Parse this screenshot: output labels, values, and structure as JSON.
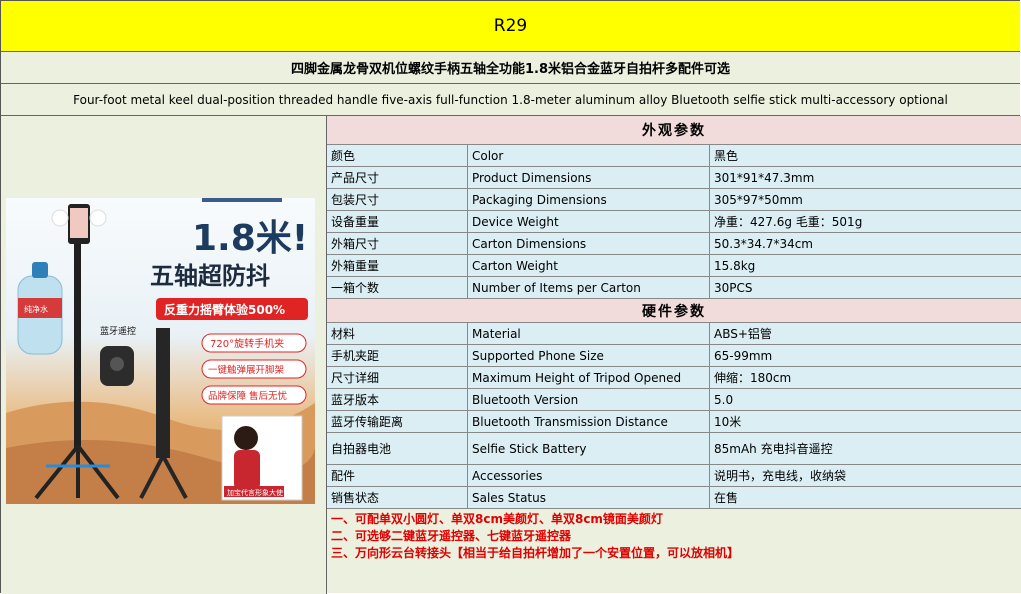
{
  "header": {
    "model": "R29",
    "title_cn": "四脚金属龙骨双机位螺纹手柄五轴全功能1.8米铝合金蓝牙自拍杆多配件可选",
    "title_en": "Four-foot metal keel dual-position threaded handle five-axis full-function 1.8-meter aluminum alloy Bluetooth selfie stick multi-accessory optional"
  },
  "image": {
    "headline": "1.8米!",
    "subheadline": "五轴超防抖",
    "banner": "反重力摇臂体验500%",
    "remote_label": "蓝牙遥控",
    "pill1": "720°旋转手机夹",
    "pill2": "一键触弹展开脚架",
    "pill3": "品牌保障 售后无忧",
    "ambassador": "加宝代言形象大使",
    "bottle_text": "纯净水"
  },
  "appearance": {
    "heading": "外观参数",
    "rows": [
      {
        "cn": "颜色",
        "en": "Color",
        "value": "黑色"
      },
      {
        "cn": "产品尺寸",
        "en": "Product Dimensions",
        "value": "301*91*47.3mm"
      },
      {
        "cn": "包装尺寸",
        "en": "Packaging Dimensions",
        "value": "305*97*50mm"
      },
      {
        "cn": "设备重量",
        "en": "Device Weight",
        "value": "净重：427.6g  毛重：501g"
      },
      {
        "cn": "外箱尺寸",
        "en": "Carton Dimensions",
        "value": "50.3*34.7*34cm"
      },
      {
        "cn": "外箱重量",
        "en": "Carton Weight",
        "value": "15.8kg"
      },
      {
        "cn": "一箱个数",
        "en": "Number of Items per Carton",
        "value": "30PCS"
      }
    ]
  },
  "hardware": {
    "heading": "硬件参数",
    "rows": [
      {
        "cn": "材料",
        "en": "Material",
        "value": "ABS+铝管"
      },
      {
        "cn": "手机夹距",
        "en": "Supported Phone Size",
        "value": "65-99mm"
      },
      {
        "cn": "尺寸详细",
        "en": "Maximum Height of Tripod Opened",
        "value": "伸缩：180cm"
      },
      {
        "cn": "蓝牙版本",
        "en": "Bluetooth Version",
        "value": "5.0"
      },
      {
        "cn": "蓝牙传输距离",
        "en": "Bluetooth Transmission Distance",
        "value": "10米"
      },
      {
        "cn": "自拍器电池",
        "en": "Selfie Stick Battery",
        "value": "85mAh 充电抖音遥控"
      },
      {
        "cn": "配件",
        "en": "Accessories",
        "value": "说明书，充电线，收纳袋"
      },
      {
        "cn": "销售状态",
        "en": "Sales Status",
        "value": "在售"
      }
    ]
  },
  "notes": [
    "一、可配单双小圆灯、单双8cm美颜灯、单双8cm镜面美颜灯",
    "二、可选够二键蓝牙遥控器、七键蓝牙遥控器",
    "三、万向形云台转接头【相当于给自拍杆增加了一个安置位置，可以放相机】"
  ],
  "colors": {
    "title_bg": "#ffff00",
    "header_bg": "#ebf1de",
    "section_bg": "#f2dcdb",
    "row_bg": "#daeef3",
    "note_text": "#e00000"
  }
}
